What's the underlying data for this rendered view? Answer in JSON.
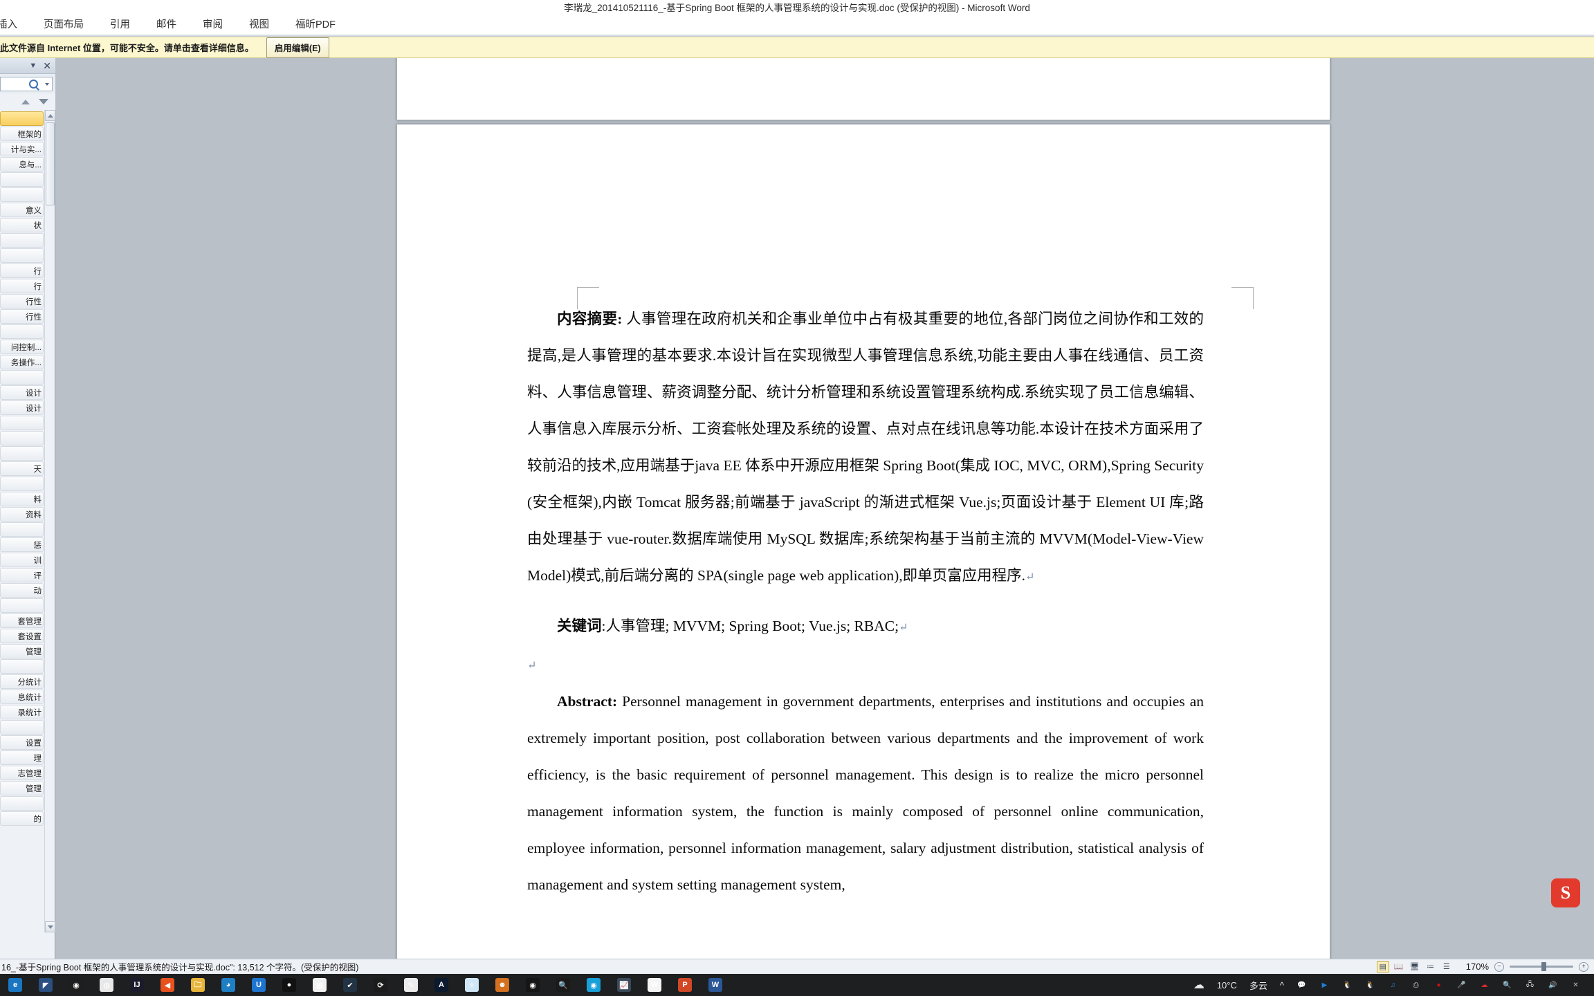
{
  "window": {
    "title": "李瑞龙_201410521116_-基于Spring Boot 框架的人事管理系统的设计与实现.doc (受保护的视图)  -  Microsoft Word"
  },
  "ribbon": {
    "tabs": [
      {
        "label": "插入"
      },
      {
        "label": "页面布局"
      },
      {
        "label": "引用"
      },
      {
        "label": "邮件"
      },
      {
        "label": "审阅"
      },
      {
        "label": "视图"
      },
      {
        "label": "福昕PDF"
      }
    ]
  },
  "protected_view_bar": {
    "message": "此文件源自 Internet 位置，可能不安全。请单击查看详细信息。",
    "enable_edit_label": "启用编辑(E)"
  },
  "navigation_pane": {
    "header": {
      "dropdown_icon": "chevron-down-icon",
      "close_icon": "close-icon"
    },
    "search": {
      "value": "",
      "placeholder": "",
      "icon": "search-icon",
      "dropdown_icon": "caret-down-icon"
    },
    "prev_icon": "triangle-up-icon",
    "next_icon": "triangle-down-icon",
    "items": [
      {
        "label": "",
        "selected": true
      },
      {
        "label": "框架的"
      },
      {
        "label": "计与实..."
      },
      {
        "label": "息与..."
      },
      {
        "label": ""
      },
      {
        "label": ""
      },
      {
        "label": "意义"
      },
      {
        "label": "状"
      },
      {
        "label": ""
      },
      {
        "label": ""
      },
      {
        "label": "行"
      },
      {
        "label": "行"
      },
      {
        "label": "行性"
      },
      {
        "label": "行性"
      },
      {
        "label": ""
      },
      {
        "label": "问控制..."
      },
      {
        "label": "务操作..."
      },
      {
        "label": ""
      },
      {
        "label": "设计"
      },
      {
        "label": "设计"
      },
      {
        "label": ""
      },
      {
        "label": ""
      },
      {
        "label": ""
      },
      {
        "label": "天"
      },
      {
        "label": ""
      },
      {
        "label": "料"
      },
      {
        "label": "资料"
      },
      {
        "label": ""
      },
      {
        "label": "惩"
      },
      {
        "label": "训"
      },
      {
        "label": "评"
      },
      {
        "label": "动"
      },
      {
        "label": ""
      },
      {
        "label": "套管理"
      },
      {
        "label": "套设置"
      },
      {
        "label": "管理"
      },
      {
        "label": ""
      },
      {
        "label": "分统计"
      },
      {
        "label": "息统计"
      },
      {
        "label": "录统计"
      },
      {
        "label": ""
      },
      {
        "label": "设置"
      },
      {
        "label": "理"
      },
      {
        "label": "志管理"
      },
      {
        "label": "管理"
      },
      {
        "label": ""
      },
      {
        "label": "的"
      }
    ]
  },
  "document": {
    "abstract_cn": {
      "lead": "内容摘要:",
      "body": " 人事管理在政府机关和企事业单位中占有极其重要的地位,各部门岗位之间协作和工效的提高,是人事管理的基本要求.本设计旨在实现微型人事管理信息系统,功能主要由人事在线通信、员工资料、人事信息管理、薪资调整分配、统计分析管理和系统设置管理系统构成.系统实现了员工信息编辑、人事信息入库展示分析、工资套帐处理及系统的设置、点对点在线讯息等功能.本设计在技术方面采用了较前沿的技术,应用端基于java EE 体系中开源应用框架 Spring Boot(集成 IOC, MVC, ORM),Spring Security (安全框架),内嵌 Tomcat 服务器;前端基于 javaScript 的渐进式框架 Vue.js;页面设计基于 Element UI 库;路由处理基于 vue-router.数据库端使用 MySQL 数据库;系统架构基于当前主流的 MVVM(Model-View-View Model)模式,前后端分离的 SPA(single page web application),即单页富应用程序."
    },
    "keywords_cn": {
      "lead": "关键词",
      "body": ":人事管理; MVVM; Spring Boot; Vue.js; RBAC;"
    },
    "abstract_en": {
      "lead": "Abstract:",
      "body": " Personnel management in government departments, enterprises and institutions and occupies an extremely important position, post collaboration between various departments and the improvement of work efficiency, is the basic requirement of personnel management. This design is to realize the micro personnel management information system, the function is mainly composed of personnel online communication, employee information, personnel information management, salary adjustment distribution, statistical analysis of management and system setting management system,"
    },
    "pilcrow": "↵"
  },
  "status_bar": {
    "text": "16_-基于Spring Boot 框架的人事管理系统的设计与实现.doc\": 13,512 个字符。(受保护的视图)",
    "zoom": "170%",
    "view_buttons": [
      {
        "name": "print-layout-view",
        "glyph": "▤",
        "active": true
      },
      {
        "name": "full-screen-reading-view",
        "glyph": "📖",
        "active": false
      },
      {
        "name": "web-layout-view",
        "glyph": "🖥",
        "active": false
      },
      {
        "name": "outline-view",
        "glyph": "≔",
        "active": false
      },
      {
        "name": "draft-view",
        "glyph": "☰",
        "active": false
      }
    ],
    "zoom_out_label": "−",
    "zoom_in_label": "+"
  },
  "taskbar": {
    "items": [
      {
        "name": "taskbar-icon-edge-legacy",
        "glyph": "e",
        "color": "#1b76c2",
        "running": false
      },
      {
        "name": "taskbar-icon-blue-bird",
        "glyph": "◤",
        "color": "#2a4f80",
        "running": false
      },
      {
        "name": "taskbar-icon-green-globe",
        "glyph": "◉",
        "color": "#1e1e1e",
        "running": false
      },
      {
        "name": "taskbar-icon-chrome",
        "glyph": "◍",
        "color": "#e8e8e8",
        "running": true
      },
      {
        "name": "taskbar-icon-intellij-idea",
        "glyph": "IJ",
        "color": "#1b1b2b",
        "running": false
      },
      {
        "name": "taskbar-icon-orange-arrow",
        "glyph": "◀",
        "color": "#e8521f",
        "running": true
      },
      {
        "name": "taskbar-icon-file-explorer",
        "glyph": "🗀",
        "color": "#e8b53a",
        "running": true
      },
      {
        "name": "taskbar-icon-blue-drop",
        "glyph": "◕",
        "color": "#1f7fc4",
        "running": false
      },
      {
        "name": "taskbar-icon-u-app",
        "glyph": "U",
        "color": "#1f74d0",
        "running": true
      },
      {
        "name": "taskbar-icon-record-red",
        "glyph": "●",
        "color": "#111111",
        "running": false
      },
      {
        "name": "taskbar-icon-calendar",
        "glyph": "▦",
        "color": "#f2f2f2",
        "running": false
      },
      {
        "name": "taskbar-icon-green-check",
        "glyph": "✔",
        "color": "#223344",
        "running": false
      },
      {
        "name": "taskbar-icon-sync-green",
        "glyph": "⟳",
        "color": "#1b1b1b",
        "running": false
      },
      {
        "name": "taskbar-icon-paint",
        "glyph": "✎",
        "color": "#ececec",
        "running": false
      },
      {
        "name": "taskbar-icon-acrobat",
        "glyph": "A",
        "color": "#0b1a2e",
        "running": false
      },
      {
        "name": "taskbar-icon-atom-blue",
        "glyph": "⚛",
        "color": "#cfe6f7",
        "running": false
      },
      {
        "name": "taskbar-icon-avatar-person",
        "glyph": "☻",
        "color": "#d4701f",
        "running": true,
        "active": true
      },
      {
        "name": "taskbar-icon-obs-record",
        "glyph": "◉",
        "color": "#161616",
        "running": false
      },
      {
        "name": "taskbar-icon-search-orange",
        "glyph": "🔍",
        "color": "#1a1a1a",
        "running": true
      },
      {
        "name": "taskbar-icon-edge-chromium",
        "glyph": "◉",
        "color": "#18a0d8",
        "running": true
      },
      {
        "name": "taskbar-icon-chart-app",
        "glyph": "📈",
        "color": "#3a4a5a",
        "running": false
      },
      {
        "name": "taskbar-icon-wps-writer",
        "glyph": "W",
        "color": "#f5f5f5",
        "running": true
      },
      {
        "name": "taskbar-icon-powerpoint",
        "glyph": "P",
        "color": "#d24726",
        "running": true
      },
      {
        "name": "taskbar-icon-word",
        "glyph": "W",
        "color": "#2b5797",
        "running": true,
        "active": false
      }
    ],
    "tray": {
      "weather_icon": "cloud-icon",
      "temperature": "10°C",
      "weather_text": "多云",
      "expand_icon": "chevron-up-icon",
      "icons": [
        {
          "name": "tray-icon-wechat",
          "glyph": "💬",
          "color": "#2aae42"
        },
        {
          "name": "tray-icon-media-player",
          "glyph": "▶",
          "color": "#1f7fd4"
        },
        {
          "name": "tray-icon-qq-1",
          "glyph": "🐧",
          "color": "#c22424"
        },
        {
          "name": "tray-icon-qq-2",
          "glyph": "🐧",
          "color": "#c22424"
        },
        {
          "name": "tray-icon-qq-music",
          "glyph": "♫",
          "color": "#2a7fd0"
        },
        {
          "name": "tray-icon-usb-eject",
          "glyph": "⎙",
          "color": "#d8d8d8"
        },
        {
          "name": "tray-icon-record",
          "glyph": "●",
          "color": "#cc1111"
        },
        {
          "name": "tray-icon-microphone",
          "glyph": "🎤",
          "color": "#dddddd"
        },
        {
          "name": "tray-icon-cloud-red",
          "glyph": "☁",
          "color": "#d92b2b"
        },
        {
          "name": "tray-icon-search-orange",
          "glyph": "🔍",
          "color": "#e08010"
        },
        {
          "name": "tray-icon-network",
          "glyph": "🖧",
          "color": "#e0e0e0"
        },
        {
          "name": "tray-icon-volume",
          "glyph": "🔊",
          "color": "#e0e0e0"
        },
        {
          "name": "tray-icon-close-x",
          "glyph": "✕",
          "color": "#bbbbbb"
        }
      ]
    }
  },
  "floating_widget": {
    "label": "S"
  },
  "colors": {
    "warn_bar": "#fdf7cf",
    "selection": "#f8cf5e",
    "desktop_gray": "#b9c0c8",
    "taskbar": "#1d1f21",
    "accent_red": "#e23b2e"
  }
}
